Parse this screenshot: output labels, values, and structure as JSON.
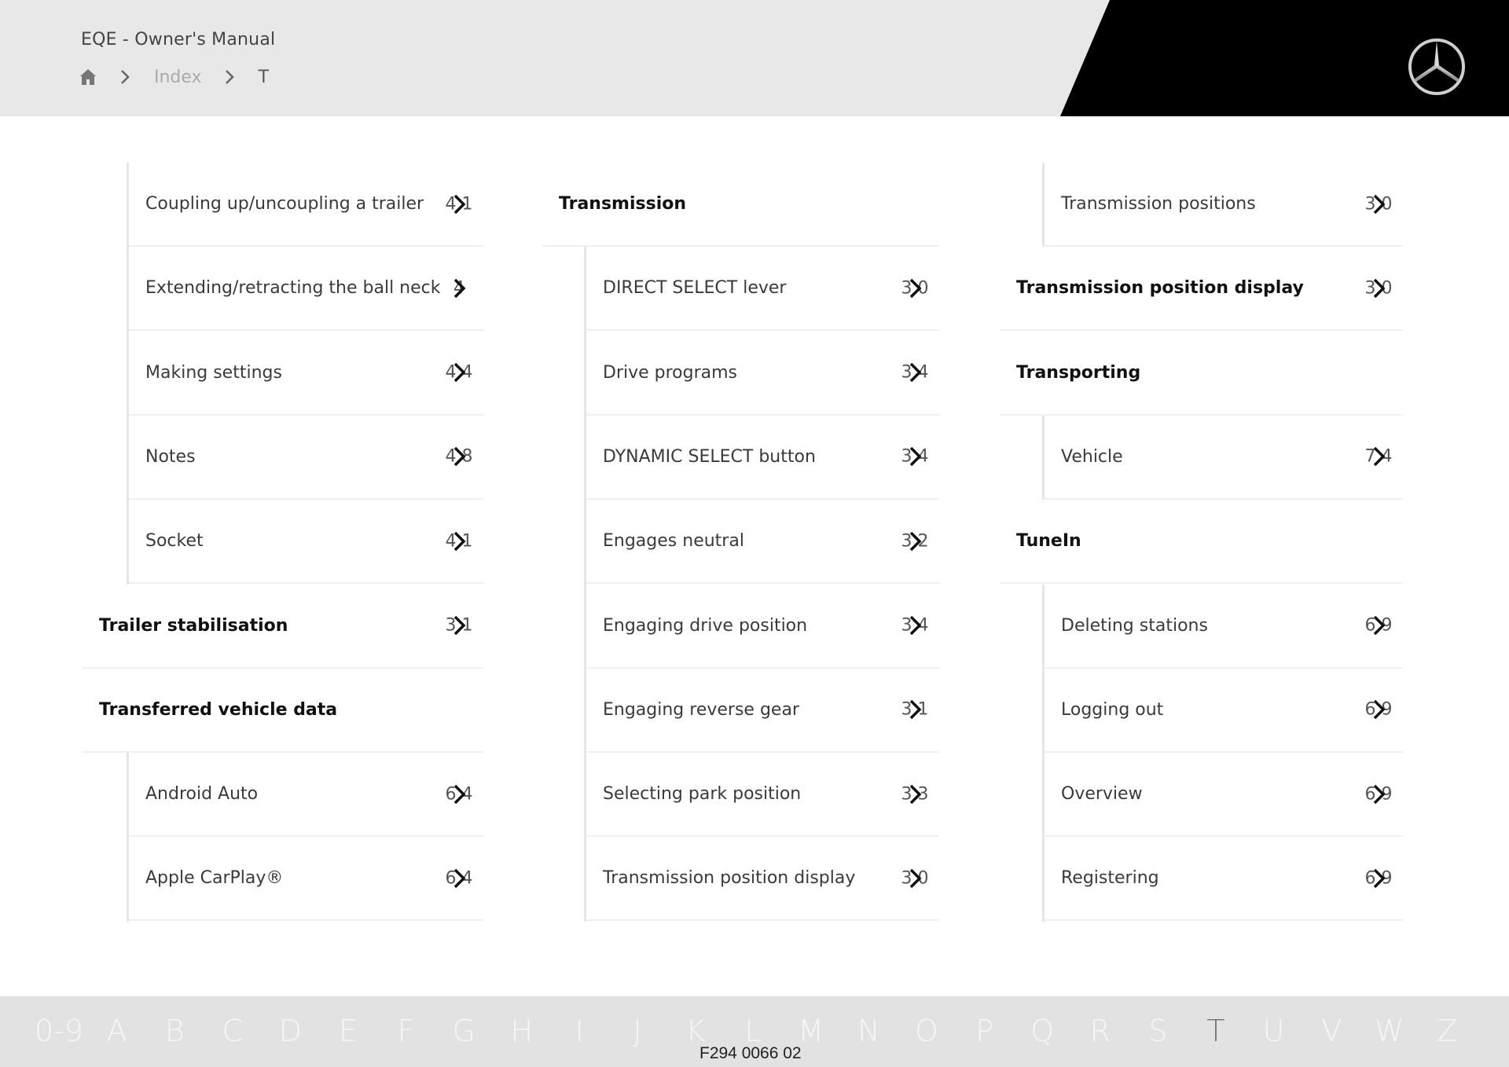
{
  "header": {
    "title": "EQE - Owner's Manual",
    "breadcrumb": {
      "home_icon": "home-icon",
      "items": [
        "Index",
        "T"
      ]
    },
    "logo": "mercedes-star-logo"
  },
  "columns": [
    {
      "rows": [
        {
          "type": "child",
          "label": "Coupling up/uncoupling a trailer",
          "page": "4 1"
        },
        {
          "type": "child",
          "label": "Extending/retracting the ball neck",
          "page": "4"
        },
        {
          "type": "child",
          "label": "Making settings",
          "page": "4 4"
        },
        {
          "type": "child",
          "label": "Notes",
          "page": "4 8"
        },
        {
          "type": "child",
          "label": "Socket",
          "page": "4 1"
        },
        {
          "type": "parent",
          "label": "Trailer stabilisation",
          "page": "3 1"
        },
        {
          "type": "parent",
          "label": "Transferred vehicle data",
          "page": ""
        },
        {
          "type": "child",
          "label": "Android Auto",
          "page": "6 4"
        },
        {
          "type": "child",
          "label": "Apple CarPlay®",
          "page": "6 4"
        }
      ]
    },
    {
      "rows": [
        {
          "type": "parent",
          "label": "Transmission",
          "page": ""
        },
        {
          "type": "child",
          "label": "DIRECT SELECT lever",
          "page": "3 0"
        },
        {
          "type": "child",
          "label": "Drive programs",
          "page": "3 4"
        },
        {
          "type": "child",
          "label": "DYNAMIC SELECT button",
          "page": "3 4"
        },
        {
          "type": "child",
          "label": "Engages neutral",
          "page": "3 2"
        },
        {
          "type": "child",
          "label": "Engaging drive position",
          "page": "3 4"
        },
        {
          "type": "child",
          "label": "Engaging reverse gear",
          "page": "3 1"
        },
        {
          "type": "child",
          "label": "Selecting park position",
          "page": "3 3"
        },
        {
          "type": "child",
          "label": "Transmission position display",
          "page": "3 0"
        }
      ]
    },
    {
      "rows": [
        {
          "type": "child",
          "label": "Transmission positions",
          "page": "3 0"
        },
        {
          "type": "parent",
          "label": "Transmission position display",
          "page": "3 0"
        },
        {
          "type": "parent",
          "label": "Transporting",
          "page": ""
        },
        {
          "type": "child",
          "label": "Vehicle",
          "page": "7 4"
        },
        {
          "type": "parent",
          "label": "TuneIn",
          "page": ""
        },
        {
          "type": "child",
          "label": "Deleting stations",
          "page": "6 9"
        },
        {
          "type": "child",
          "label": "Logging out",
          "page": "6 9"
        },
        {
          "type": "child",
          "label": "Overview",
          "page": "6 9"
        },
        {
          "type": "child",
          "label": "Registering",
          "page": "6 9"
        }
      ]
    }
  ],
  "alphabet": {
    "letters": [
      "0-9",
      "A",
      "B",
      "C",
      "D",
      "E",
      "F",
      "G",
      "H",
      "I",
      "J",
      "K",
      "L",
      "M",
      "N",
      "O",
      "P",
      "Q",
      "R",
      "S",
      "T",
      "U",
      "V",
      "W",
      "Z"
    ],
    "active": "T"
  },
  "footer": {
    "code": "F294 0066 02"
  },
  "colors": {
    "header_bg": "#e8e8e8",
    "brand_black": "#000000",
    "footer_bg": "#e2e2e2"
  }
}
